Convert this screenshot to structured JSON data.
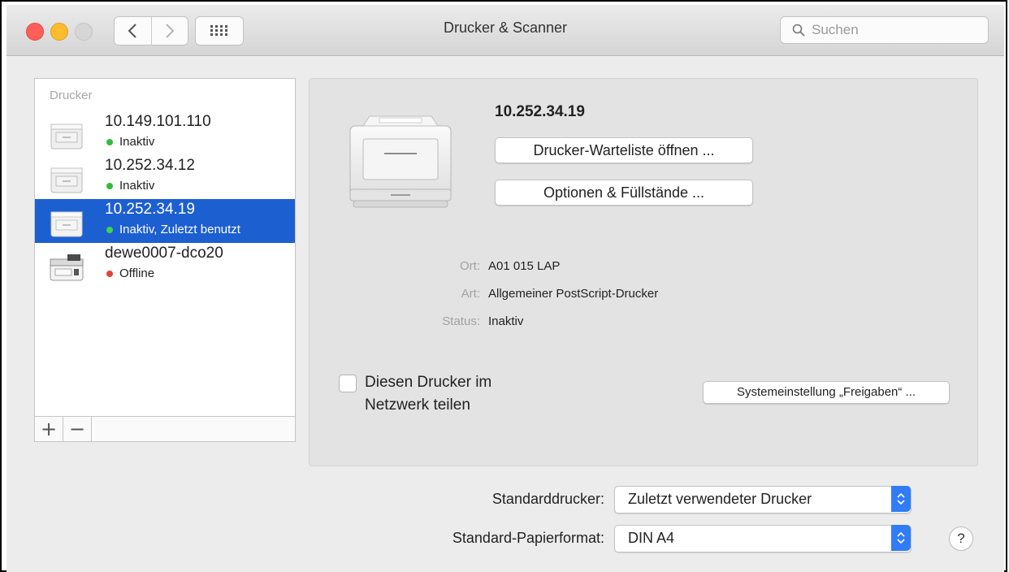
{
  "window": {
    "title": "Drucker & Scanner",
    "search": {
      "placeholder": "Suchen",
      "value": ""
    }
  },
  "printer_list": {
    "heading": "Drucker",
    "items": [
      {
        "name": "10.149.101.110",
        "status": "Inaktiv",
        "status_color": "#2fbd3c",
        "selected": false
      },
      {
        "name": "10.252.34.12",
        "status": "Inaktiv",
        "status_color": "#2fbd3c",
        "selected": false
      },
      {
        "name": "10.252.34.19",
        "status": "Inaktiv, Zuletzt benutzt",
        "status_color": "#42d34f",
        "selected": true
      },
      {
        "name": "dewe0007-dco20",
        "status": "Offline",
        "status_color": "#e2433b",
        "selected": false
      }
    ],
    "add_label": "+",
    "remove_label": "−"
  },
  "detail": {
    "printer_name": "10.252.34.19",
    "open_queue_label": "Drucker-Warteliste öffnen ...",
    "options_label": "Optionen & Füllstände ...",
    "info": [
      {
        "label": "Ort:",
        "value": "A01 015 LAP"
      },
      {
        "label": "Art:",
        "value": "Allgemeiner PostScript-Drucker"
      },
      {
        "label": "Status:",
        "value": "Inaktiv"
      }
    ],
    "share": {
      "label_line1": "Diesen Drucker im",
      "label_line2": "Netzwerk teilen",
      "checked": false
    },
    "sharing_prefs_label": "Systemeinstellung „Freigaben“ ..."
  },
  "defaults": {
    "default_printer_label": "Standarddrucker:",
    "default_printer_value": "Zuletzt verwendeter Drucker",
    "paper_size_label": "Standard-Papierformat:",
    "paper_size_value": "DIN A4"
  },
  "help_label": "?",
  "colors": {
    "selection": "#1c5fd1",
    "close": "#fc5f57",
    "minimize": "#fdbc2e",
    "popup_accent": "#2f7cf6"
  },
  "icons": [
    "back-chevron-icon",
    "forward-chevron-icon",
    "show-all-grid-icon",
    "search-icon",
    "printer-icon",
    "popup-stepper-icon"
  ]
}
